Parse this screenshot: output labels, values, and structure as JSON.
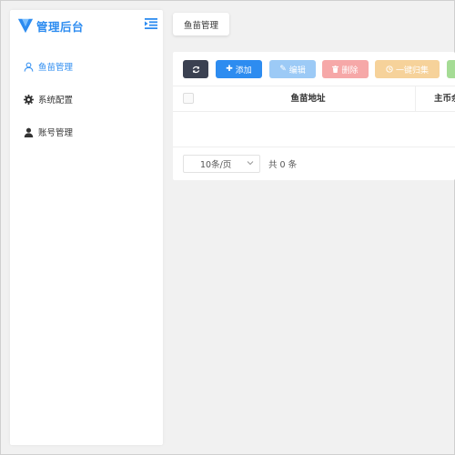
{
  "brand": {
    "title": "管理后台",
    "logo_icon": "v-shield-logo",
    "accent": "#2d8cf0"
  },
  "sidebar": {
    "items": [
      {
        "label": "鱼苗管理",
        "icon": "user-outline-icon",
        "active": true
      },
      {
        "label": "系统配置",
        "icon": "gear-icon",
        "active": false
      },
      {
        "label": "账号管理",
        "icon": "user-solid-icon",
        "active": false
      }
    ]
  },
  "tabs": [
    {
      "label": "鱼苗管理"
    }
  ],
  "toolbar": {
    "add_label": "添加",
    "edit_label": "编辑",
    "delete_label": "删除",
    "collect_label": "一键归集"
  },
  "table": {
    "columns": [
      "鱼苗地址",
      "主币余"
    ],
    "rows": []
  },
  "pagination": {
    "page_size": "10条/页",
    "total": "共 0 条"
  },
  "colors": {
    "primary": "#2d8cf0",
    "dark": "#3b4151",
    "edit": "#9ccaf6",
    "delete": "#f6a8a8",
    "collect": "#f6d29a",
    "extra": "#a5dc95"
  }
}
